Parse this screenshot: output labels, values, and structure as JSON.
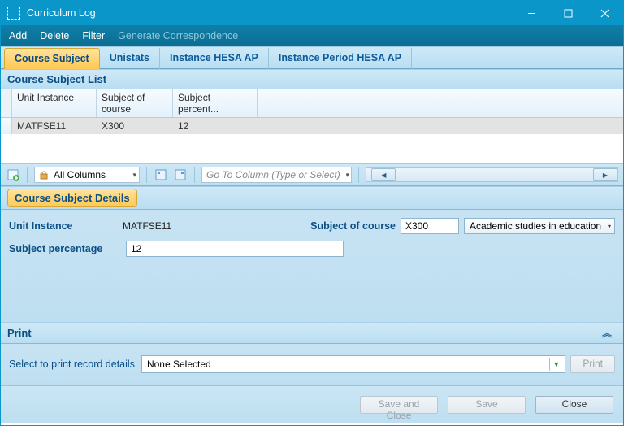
{
  "window": {
    "title": "Curriculum Log"
  },
  "menu": {
    "add": "Add",
    "delete": "Delete",
    "filter": "Filter",
    "gen_corr": "Generate Correspondence"
  },
  "tabs": {
    "t0": "Course Subject",
    "t1": "Unistats",
    "t2": "Instance HESA AP",
    "t3": "Instance Period HESA AP"
  },
  "list": {
    "title": "Course Subject List",
    "cols": {
      "c0": "Unit Instance",
      "c1": "Subject of course",
      "c2": "Subject percent..."
    },
    "rows": [
      {
        "c0": "MATFSE11",
        "c1": "X300",
        "c2": "12"
      }
    ]
  },
  "toolbar": {
    "all_columns": "All Columns",
    "lock_icon": "lock",
    "goto_placeholder": "Go To Column (Type or Select)"
  },
  "details": {
    "title": "Course Subject Details",
    "labels": {
      "unit_instance": "Unit Instance",
      "subject_of_course": "Subject of course",
      "subject_perc_full": "Subject percentage"
    },
    "unit_instance": "MATFSE11",
    "subject_of_course": "X300",
    "subject_desc": "Academic studies in education",
    "subject_percentage": "12"
  },
  "print": {
    "title": "Print",
    "label": "Select to print record details",
    "selected": "None Selected",
    "print_btn": "Print"
  },
  "footer": {
    "save_close": "Save and Close",
    "save": "Save",
    "close": "Close"
  }
}
